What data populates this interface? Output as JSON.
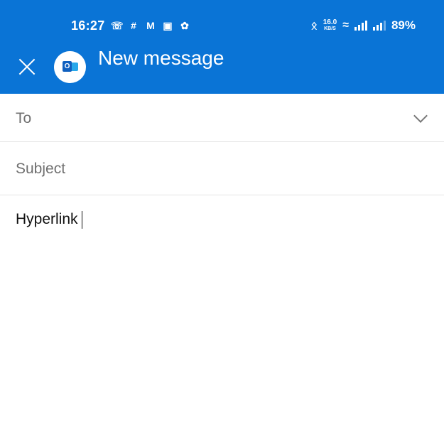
{
  "status_bar": {
    "time": "16:27",
    "notification_icons": [
      "whatsapp-icon",
      "slack-icon",
      "gmail-icon",
      "instagram-icon",
      "pinwheel-icon"
    ],
    "bluetooth": "bluetooth-icon",
    "network_speed_value": "16.0",
    "network_speed_unit": "KB/S",
    "battery": "89%"
  },
  "app_bar": {
    "title": "New message",
    "close_icon": "close-icon",
    "account_icon": "outlook-icon",
    "account_letter": "O",
    "background_color": "#0a74d6"
  },
  "compose": {
    "to_label": "To",
    "subject_label": "Subject",
    "body_text": "Hyperlink"
  }
}
